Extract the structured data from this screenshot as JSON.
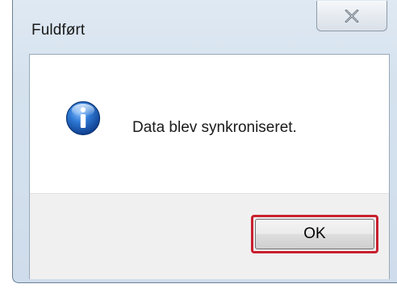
{
  "window": {
    "title": "Fuldført",
    "close_icon": "close-x-icon"
  },
  "dialog": {
    "icon": "info-icon",
    "message": "Data blev synkroniseret.",
    "ok_label": "OK"
  },
  "colors": {
    "highlight": "#c8202e",
    "icon_blue": "#2a6fc7"
  }
}
